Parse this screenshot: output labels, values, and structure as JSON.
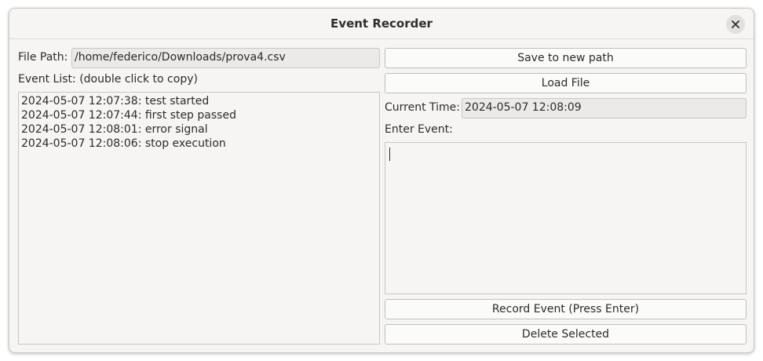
{
  "window": {
    "title": "Event Recorder",
    "close_icon": "close-icon"
  },
  "file": {
    "label": "File Path:",
    "value": "/home/federico/Downloads/prova4.csv"
  },
  "buttons": {
    "save": "Save to new path",
    "load": "Load File",
    "record": "Record Event (Press Enter)",
    "delete": "Delete Selected"
  },
  "event_list": {
    "label": "Event List: (double click to copy)",
    "items": [
      "2024-05-07 12:07:38: test started",
      "2024-05-07 12:07:44: first step passed",
      "2024-05-07 12:08:01: error signal",
      "2024-05-07 12:08:06: stop execution"
    ]
  },
  "time": {
    "label": "Current Time:",
    "value": "2024-05-07 12:08:09"
  },
  "event_input": {
    "label": "Enter Event:",
    "value": ""
  }
}
